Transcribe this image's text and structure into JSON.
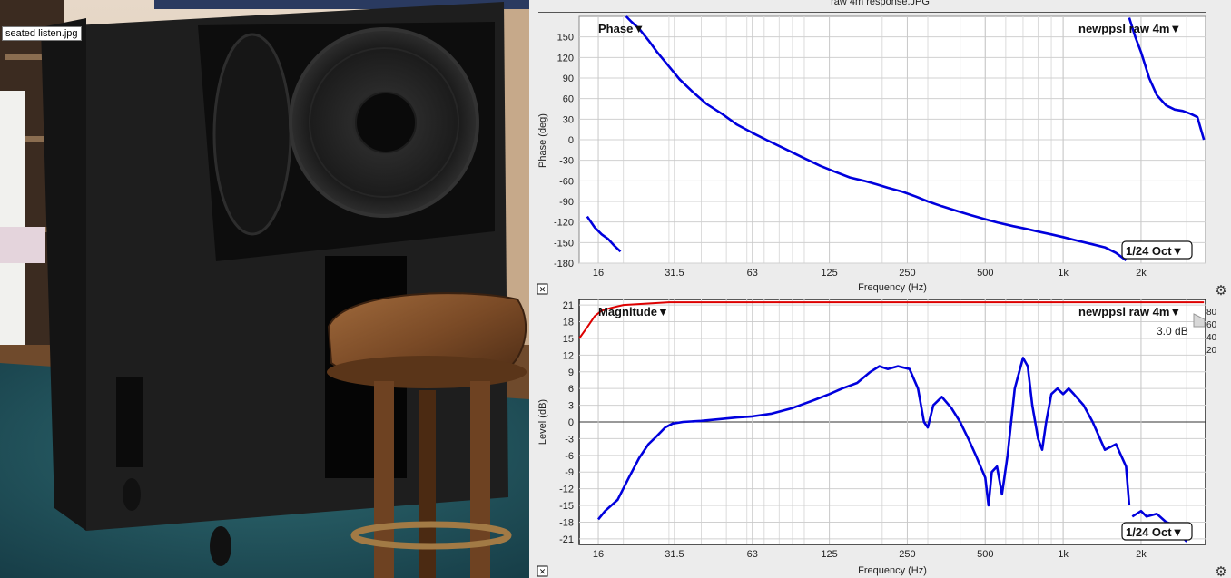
{
  "photo": {
    "filename": "seated listen.jpg"
  },
  "window": {
    "title": "raw 4m response.JPG"
  },
  "phase_panel": {
    "dropdown_label": "Phase▼",
    "measurement_label": "newppsl raw 4m▼",
    "smoothing_label": "1/24 Oct▼",
    "ylabel": "Phase (deg)",
    "xlabel": "Frequency (Hz)",
    "close_glyph": "✕",
    "settings_glyph": "⚙"
  },
  "magnitude_panel": {
    "dropdown_label": "Magnitude▼",
    "measurement_label": "newppsl raw 4m▼",
    "smoothing_label": "1/24 Oct▼",
    "ylabel": "Level (dB)",
    "xlabel": "Frequency (Hz)",
    "scale_label": "3.0 dB",
    "close_glyph": "✕",
    "settings_glyph": "⚙",
    "right_axis_ticks": [
      "80",
      "60",
      "40",
      "20"
    ]
  },
  "chart_data": [
    {
      "type": "line",
      "title": "",
      "xlabel": "Frequency (Hz)",
      "ylabel": "Phase (deg)",
      "x_scale": "log",
      "xlim": [
        13.5,
        3550
      ],
      "ylim": [
        -180,
        180
      ],
      "x_ticks": [
        {
          "v": 16,
          "l": "16"
        },
        {
          "v": 31.5,
          "l": "31.5"
        },
        {
          "v": 63,
          "l": "63"
        },
        {
          "v": 125,
          "l": "125"
        },
        {
          "v": 250,
          "l": "250"
        },
        {
          "v": 500,
          "l": "500"
        },
        {
          "v": 1000,
          "l": "1k"
        },
        {
          "v": 2000,
          "l": "2k"
        }
      ],
      "y_ticks": [
        150,
        120,
        90,
        60,
        30,
        0,
        -30,
        -60,
        -90,
        -120,
        -150,
        -180
      ],
      "grid": true,
      "series": [
        {
          "color": "#0000dd",
          "segments": [
            [
              [
                14.5,
                -112
              ],
              [
                15.5,
                -128
              ],
              [
                16.5,
                -138
              ],
              [
                17.5,
                -145
              ],
              [
                18.5,
                -155
              ],
              [
                19.5,
                -163
              ]
            ],
            [
              [
                20.5,
                180
              ],
              [
                21.5,
                172
              ],
              [
                23,
                162
              ],
              [
                25,
                145
              ],
              [
                27,
                128
              ],
              [
                30,
                107
              ],
              [
                33,
                88
              ],
              [
                37,
                70
              ],
              [
                42,
                52
              ],
              [
                48,
                38
              ],
              [
                55,
                22
              ],
              [
                63,
                10
              ],
              [
                73,
                -2
              ],
              [
                85,
                -14
              ],
              [
                100,
                -27
              ],
              [
                115,
                -38
              ],
              [
                130,
                -46
              ],
              [
                150,
                -55
              ],
              [
                170,
                -60
              ],
              [
                190,
                -65
              ],
              [
                210,
                -70
              ],
              [
                240,
                -76
              ],
              [
                270,
                -83
              ],
              [
                300,
                -90
              ],
              [
                340,
                -97
              ],
              [
                390,
                -104
              ],
              [
                440,
                -110
              ],
              [
                500,
                -116
              ],
              [
                560,
                -121
              ],
              [
                640,
                -126
              ],
              [
                720,
                -130
              ],
              [
                800,
                -134
              ],
              [
                900,
                -138
              ],
              [
                1000,
                -142
              ],
              [
                1130,
                -147
              ],
              [
                1280,
                -152
              ],
              [
                1450,
                -157
              ],
              [
                1600,
                -165
              ],
              [
                1750,
                -176
              ]
            ],
            [
              [
                1800,
                178
              ],
              [
                1900,
                150
              ],
              [
                2000,
                128
              ],
              [
                2150,
                90
              ],
              [
                2300,
                65
              ],
              [
                2500,
                50
              ],
              [
                2700,
                44
              ],
              [
                2900,
                42
              ],
              [
                3100,
                38
              ],
              [
                3300,
                33
              ],
              [
                3500,
                0
              ]
            ]
          ]
        }
      ]
    },
    {
      "type": "line",
      "title": "",
      "xlabel": "Frequency (Hz)",
      "ylabel": "Level (dB)",
      "x_scale": "log",
      "xlim": [
        13.5,
        3550
      ],
      "ylim": [
        -22,
        22
      ],
      "x_ticks": [
        {
          "v": 16,
          "l": "16"
        },
        {
          "v": 31.5,
          "l": "31.5"
        },
        {
          "v": 63,
          "l": "63"
        },
        {
          "v": 125,
          "l": "125"
        },
        {
          "v": 250,
          "l": "250"
        },
        {
          "v": 500,
          "l": "500"
        },
        {
          "v": 1000,
          "l": "1k"
        },
        {
          "v": 2000,
          "l": "2k"
        }
      ],
      "y_ticks": [
        21,
        18,
        15,
        12,
        9,
        6,
        3,
        0,
        -3,
        -6,
        -9,
        -12,
        -15,
        -18,
        -21
      ],
      "grid": true,
      "series": [
        {
          "color": "#0000dd",
          "segments": [
            [
              [
                16,
                -17.5
              ],
              [
                17,
                -16
              ],
              [
                19,
                -14
              ],
              [
                21,
                -10
              ],
              [
                23,
                -6.5
              ],
              [
                25,
                -4
              ],
              [
                27,
                -2.5
              ],
              [
                29,
                -1
              ],
              [
                31,
                -0.3
              ],
              [
                34,
                0
              ],
              [
                40,
                0.2
              ],
              [
                47,
                0.5
              ],
              [
                55,
                0.8
              ],
              [
                63,
                1
              ],
              [
                75,
                1.5
              ],
              [
                90,
                2.5
              ],
              [
                110,
                4
              ],
              [
                125,
                5
              ],
              [
                140,
                6
              ],
              [
                160,
                7
              ],
              [
                180,
                9
              ],
              [
                195,
                10
              ],
              [
                210,
                9.5
              ],
              [
                230,
                10
              ],
              [
                255,
                9.5
              ],
              [
                275,
                6
              ],
              [
                290,
                0
              ],
              [
                300,
                -1
              ],
              [
                315,
                3
              ],
              [
                340,
                4.5
              ],
              [
                370,
                2.5
              ],
              [
                400,
                0
              ],
              [
                430,
                -3
              ],
              [
                460,
                -6
              ],
              [
                500,
                -10
              ],
              [
                515,
                -15
              ],
              [
                530,
                -9
              ],
              [
                555,
                -8
              ],
              [
                580,
                -13
              ],
              [
                610,
                -6
              ],
              [
                650,
                6
              ],
              [
                700,
                11.5
              ],
              [
                730,
                10
              ],
              [
                760,
                3
              ],
              [
                800,
                -3
              ],
              [
                830,
                -5
              ],
              [
                860,
                0
              ],
              [
                900,
                5
              ],
              [
                950,
                6
              ],
              [
                1000,
                5
              ],
              [
                1050,
                6
              ],
              [
                1100,
                5
              ],
              [
                1200,
                3
              ],
              [
                1300,
                0
              ],
              [
                1450,
                -5
              ],
              [
                1600,
                -4
              ],
              [
                1750,
                -8
              ],
              [
                1800,
                -15
              ]
            ],
            [
              [
                1850,
                -17
              ],
              [
                2000,
                -16
              ],
              [
                2100,
                -17
              ],
              [
                2300,
                -16.5
              ],
              [
                2500,
                -18
              ],
              [
                2700,
                -18.5
              ],
              [
                2800,
                -20
              ],
              [
                3000,
                -21.5
              ]
            ]
          ]
        },
        {
          "color": "#dd0000",
          "segments": [
            [
              [
                13.5,
                15
              ],
              [
                14.5,
                17
              ],
              [
                15.5,
                19
              ],
              [
                16.5,
                20
              ],
              [
                18,
                20.5
              ],
              [
                20,
                21
              ],
              [
                30,
                21.5
              ],
              [
                100,
                21.5
              ],
              [
                500,
                21.5
              ],
              [
                1000,
                21.5
              ],
              [
                2000,
                21.5
              ],
              [
                3500,
                21.5
              ]
            ]
          ]
        }
      ]
    }
  ]
}
